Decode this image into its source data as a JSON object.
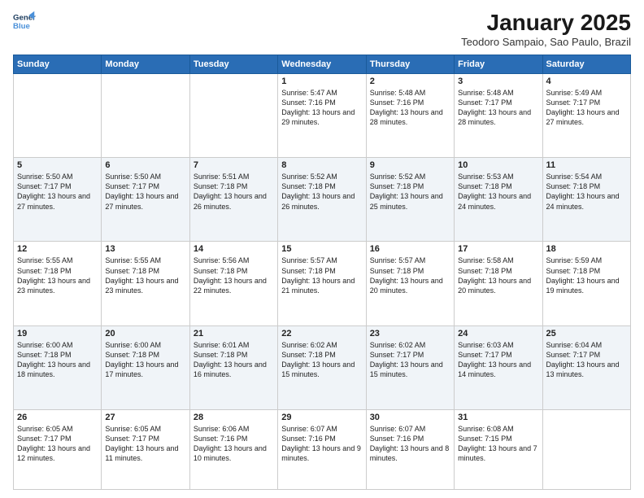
{
  "header": {
    "logo_line1": "General",
    "logo_line2": "Blue",
    "month": "January 2025",
    "location": "Teodoro Sampaio, Sao Paulo, Brazil"
  },
  "days_of_week": [
    "Sunday",
    "Monday",
    "Tuesday",
    "Wednesday",
    "Thursday",
    "Friday",
    "Saturday"
  ],
  "weeks": [
    [
      {
        "day": "",
        "text": ""
      },
      {
        "day": "",
        "text": ""
      },
      {
        "day": "",
        "text": ""
      },
      {
        "day": "1",
        "text": "Sunrise: 5:47 AM\nSunset: 7:16 PM\nDaylight: 13 hours and 29 minutes."
      },
      {
        "day": "2",
        "text": "Sunrise: 5:48 AM\nSunset: 7:16 PM\nDaylight: 13 hours and 28 minutes."
      },
      {
        "day": "3",
        "text": "Sunrise: 5:48 AM\nSunset: 7:17 PM\nDaylight: 13 hours and 28 minutes."
      },
      {
        "day": "4",
        "text": "Sunrise: 5:49 AM\nSunset: 7:17 PM\nDaylight: 13 hours and 27 minutes."
      }
    ],
    [
      {
        "day": "5",
        "text": "Sunrise: 5:50 AM\nSunset: 7:17 PM\nDaylight: 13 hours and 27 minutes."
      },
      {
        "day": "6",
        "text": "Sunrise: 5:50 AM\nSunset: 7:17 PM\nDaylight: 13 hours and 27 minutes."
      },
      {
        "day": "7",
        "text": "Sunrise: 5:51 AM\nSunset: 7:18 PM\nDaylight: 13 hours and 26 minutes."
      },
      {
        "day": "8",
        "text": "Sunrise: 5:52 AM\nSunset: 7:18 PM\nDaylight: 13 hours and 26 minutes."
      },
      {
        "day": "9",
        "text": "Sunrise: 5:52 AM\nSunset: 7:18 PM\nDaylight: 13 hours and 25 minutes."
      },
      {
        "day": "10",
        "text": "Sunrise: 5:53 AM\nSunset: 7:18 PM\nDaylight: 13 hours and 24 minutes."
      },
      {
        "day": "11",
        "text": "Sunrise: 5:54 AM\nSunset: 7:18 PM\nDaylight: 13 hours and 24 minutes."
      }
    ],
    [
      {
        "day": "12",
        "text": "Sunrise: 5:55 AM\nSunset: 7:18 PM\nDaylight: 13 hours and 23 minutes."
      },
      {
        "day": "13",
        "text": "Sunrise: 5:55 AM\nSunset: 7:18 PM\nDaylight: 13 hours and 23 minutes."
      },
      {
        "day": "14",
        "text": "Sunrise: 5:56 AM\nSunset: 7:18 PM\nDaylight: 13 hours and 22 minutes."
      },
      {
        "day": "15",
        "text": "Sunrise: 5:57 AM\nSunset: 7:18 PM\nDaylight: 13 hours and 21 minutes."
      },
      {
        "day": "16",
        "text": "Sunrise: 5:57 AM\nSunset: 7:18 PM\nDaylight: 13 hours and 20 minutes."
      },
      {
        "day": "17",
        "text": "Sunrise: 5:58 AM\nSunset: 7:18 PM\nDaylight: 13 hours and 20 minutes."
      },
      {
        "day": "18",
        "text": "Sunrise: 5:59 AM\nSunset: 7:18 PM\nDaylight: 13 hours and 19 minutes."
      }
    ],
    [
      {
        "day": "19",
        "text": "Sunrise: 6:00 AM\nSunset: 7:18 PM\nDaylight: 13 hours and 18 minutes."
      },
      {
        "day": "20",
        "text": "Sunrise: 6:00 AM\nSunset: 7:18 PM\nDaylight: 13 hours and 17 minutes."
      },
      {
        "day": "21",
        "text": "Sunrise: 6:01 AM\nSunset: 7:18 PM\nDaylight: 13 hours and 16 minutes."
      },
      {
        "day": "22",
        "text": "Sunrise: 6:02 AM\nSunset: 7:18 PM\nDaylight: 13 hours and 15 minutes."
      },
      {
        "day": "23",
        "text": "Sunrise: 6:02 AM\nSunset: 7:17 PM\nDaylight: 13 hours and 15 minutes."
      },
      {
        "day": "24",
        "text": "Sunrise: 6:03 AM\nSunset: 7:17 PM\nDaylight: 13 hours and 14 minutes."
      },
      {
        "day": "25",
        "text": "Sunrise: 6:04 AM\nSunset: 7:17 PM\nDaylight: 13 hours and 13 minutes."
      }
    ],
    [
      {
        "day": "26",
        "text": "Sunrise: 6:05 AM\nSunset: 7:17 PM\nDaylight: 13 hours and 12 minutes."
      },
      {
        "day": "27",
        "text": "Sunrise: 6:05 AM\nSunset: 7:17 PM\nDaylight: 13 hours and 11 minutes."
      },
      {
        "day": "28",
        "text": "Sunrise: 6:06 AM\nSunset: 7:16 PM\nDaylight: 13 hours and 10 minutes."
      },
      {
        "day": "29",
        "text": "Sunrise: 6:07 AM\nSunset: 7:16 PM\nDaylight: 13 hours and 9 minutes."
      },
      {
        "day": "30",
        "text": "Sunrise: 6:07 AM\nSunset: 7:16 PM\nDaylight: 13 hours and 8 minutes."
      },
      {
        "day": "31",
        "text": "Sunrise: 6:08 AM\nSunset: 7:15 PM\nDaylight: 13 hours and 7 minutes."
      },
      {
        "day": "",
        "text": ""
      }
    ]
  ]
}
